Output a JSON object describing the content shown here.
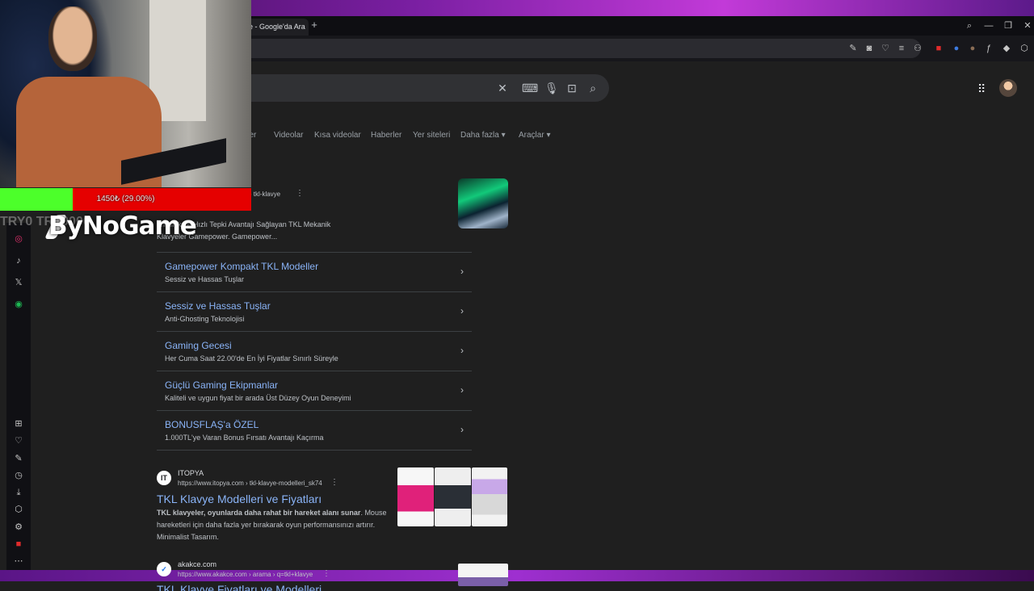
{
  "browser": {
    "tab_title": "e - Google'da Ara",
    "new_tab": "+"
  },
  "google": {
    "filters": [
      "ller",
      "Videolar",
      "Kısa videolar",
      "Haberler",
      "Yer siteleri",
      "Daha fazla ▾",
      "Araçlar ▾"
    ]
  },
  "result1": {
    "source": "m › tkl-klavye",
    "desc_1": "anıklılık ve Hızlı Tepki Avantajı Sağlayan TKL Mekanik",
    "desc_2": "Klavyeler Gamepower. Gamepower...",
    "sitelinks": [
      {
        "title": "Gamepower Kompakt TKL Modeller",
        "sub": "Sessiz ve Hassas Tuşlar"
      },
      {
        "title": "Sessiz ve Hassas Tuşlar",
        "sub": "Anti-Ghosting Teknolojisi"
      },
      {
        "title": "Gaming Gecesi",
        "sub": "Her Cuma Saat 22.00'de En İyi Fiyatlar Sınırlı Süreyle"
      },
      {
        "title": "Güçlü Gaming Ekipmanlar",
        "sub": "Kaliteli ve uygun fiyat bir arada Üst Düzey Oyun Deneyimi"
      },
      {
        "title": "BONUSFLAŞ'a ÖZEL",
        "sub": "1.000TL'ye Varan Bonus Fırsatı Avantajı Kaçırma"
      }
    ]
  },
  "result2": {
    "favicon": "IT",
    "site": "ITOPYA",
    "url": "https://www.itopya.com › tkl-klavye-modelleri_sk74",
    "title": "TKL Klavye Modelleri ve Fiyatları",
    "desc_bold": "TKL klavyeler, oyunlarda daha rahat bir hareket alanı sunar",
    "desc_rest": ". Mouse hareketleri için daha fazla yer bırakarak oyun performansınızı artırır. Minimalist Tasarım."
  },
  "result3": {
    "favicon": "✓",
    "site": "akakce.com",
    "url": "https://www.akakce.com › arama › q=tkl+klavye",
    "title": "TKL Klavye Fiyatları ve Modelleri"
  },
  "overlay": {
    "progress_text": "1450₺ (29.00%)",
    "progress_value": 0.29,
    "brand": "ByNoGame",
    "ticker": "TRY0        TRY0000"
  },
  "colors": {
    "progress_fill": "#4cff2a",
    "progress_bg": "#e50000",
    "link": "#8ab4f8"
  },
  "icons": {
    "sidebar": [
      "instagram-icon",
      "tiktok-icon",
      "x-icon",
      "spotify-icon",
      "grid-icon",
      "heart-icon",
      "edit-icon",
      "history-icon",
      "download-icon",
      "box-icon",
      "settings-icon",
      "ublock-icon",
      "more-icon"
    ]
  }
}
